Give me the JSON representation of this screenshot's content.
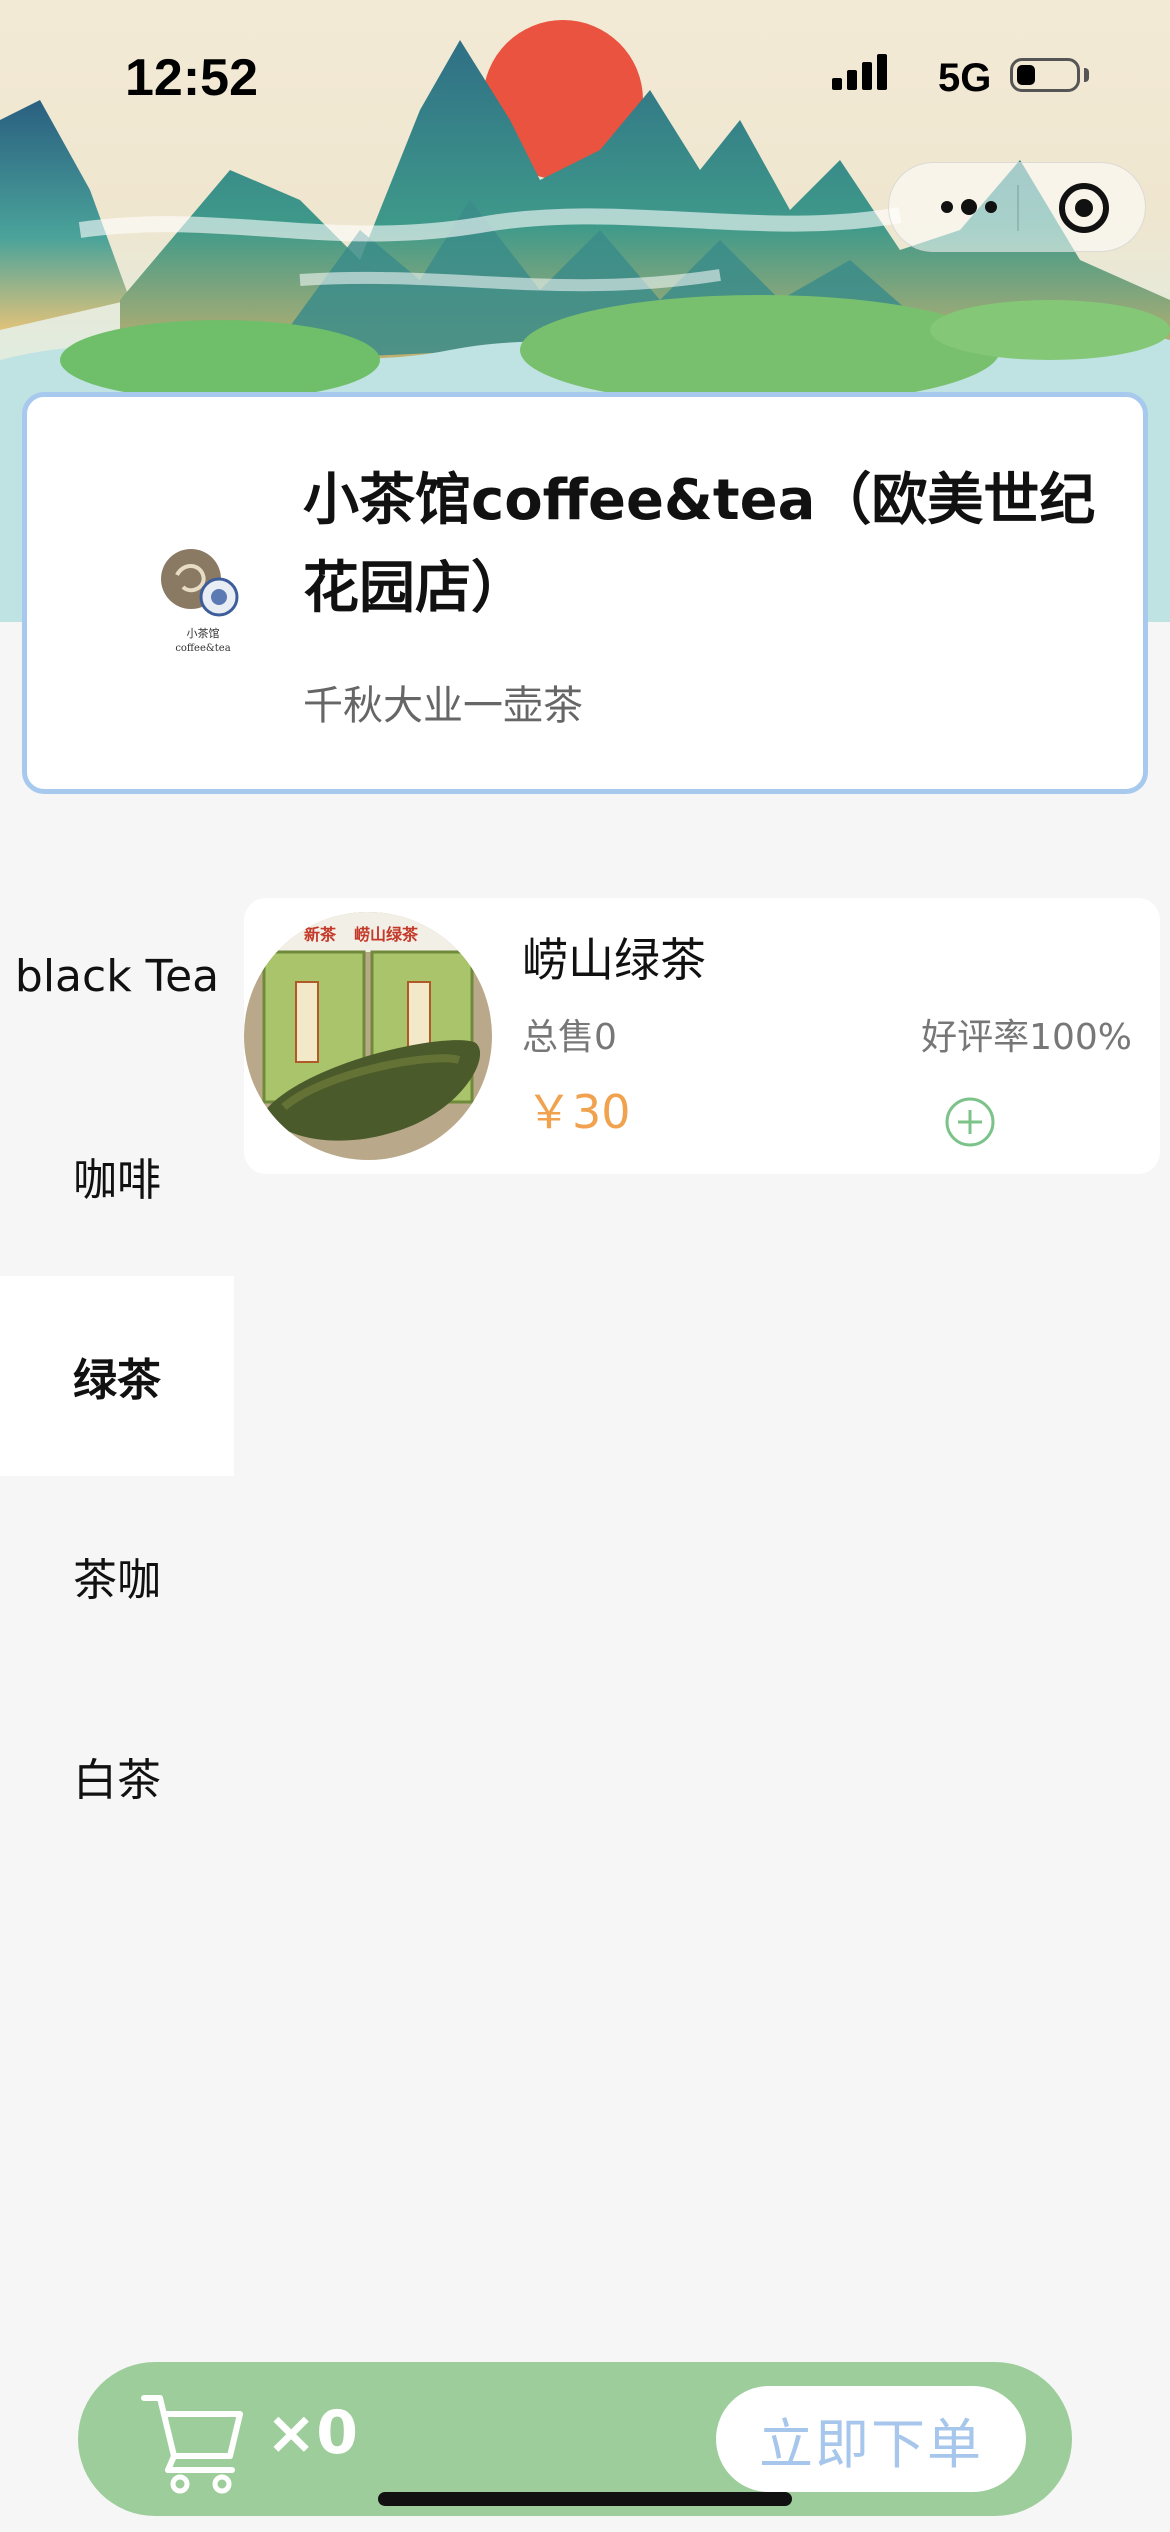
{
  "status_bar": {
    "time": "12:52",
    "network": "5G"
  },
  "colors": {
    "accent_green": "#9dcd9b",
    "price_orange": "#f0a24e",
    "card_border": "#a7c9ee",
    "order_text": "#a7c6ec"
  },
  "capsule": {
    "more_icon": "ellipsis-icon",
    "close_icon": "target-icon"
  },
  "store": {
    "name": "小茶馆coffee&tea（欧美世纪花园店）",
    "slogan": "千秋大业一壶茶"
  },
  "categories": [
    {
      "label": "black Tea",
      "active": false
    },
    {
      "label": "咖啡",
      "active": false
    },
    {
      "label": "绿茶",
      "active": true
    },
    {
      "label": "茶咖",
      "active": false
    },
    {
      "label": "白茶",
      "active": false
    }
  ],
  "products": [
    {
      "name": "崂山绿茶",
      "sales": "总售0",
      "rating": "好评率100%",
      "price": "￥30",
      "image_labels": [
        "新茶",
        "崂山绿茶"
      ]
    }
  ],
  "cart": {
    "count": "×0",
    "order_label": "立即下单",
    "icon": "cart-icon"
  }
}
